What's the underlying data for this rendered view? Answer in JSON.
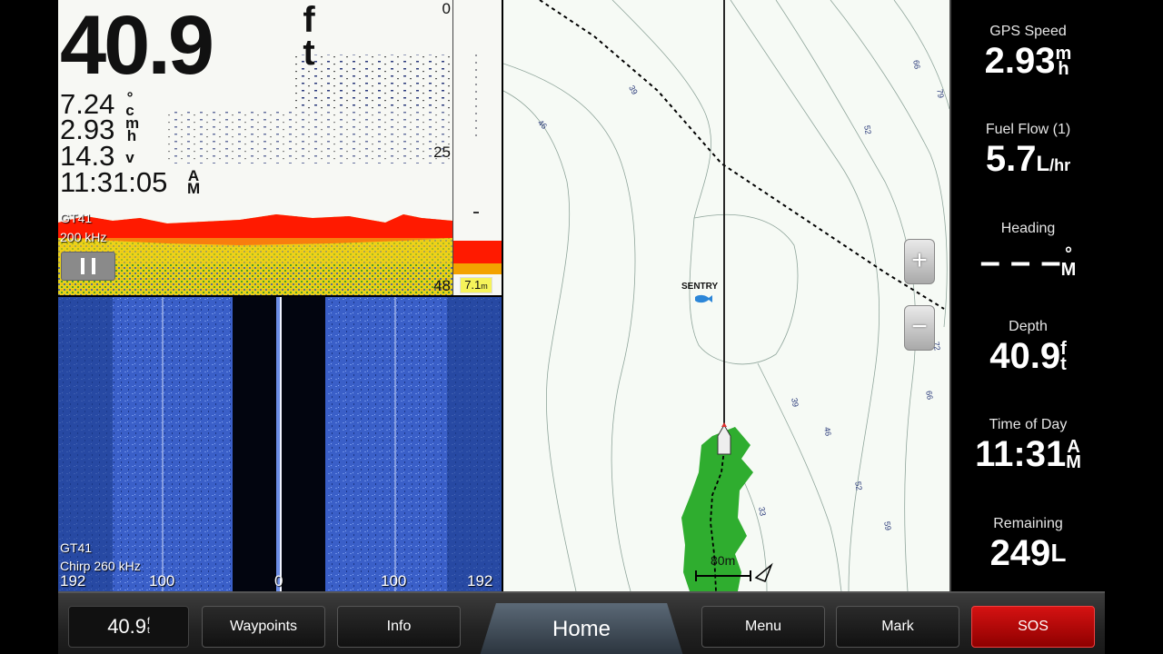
{
  "sonar": {
    "depth_value": "40.9",
    "depth_unit": [
      "f",
      "t"
    ],
    "water_temp": "7.24",
    "water_temp_unit": [
      "°",
      "c"
    ],
    "speed": "2.93",
    "speed_unit": [
      "m",
      "h"
    ],
    "voltage": "14.3",
    "voltage_unit": "v",
    "time": "11:31:05",
    "time_unit": [
      "A",
      "M"
    ],
    "transducer": "GT41",
    "frequency": "200 kHz",
    "scale": [
      "0",
      "25",
      "48"
    ],
    "flasher_depth": "7.1",
    "flasher_depth_unit": "m"
  },
  "sidescan": {
    "transducer": "GT41",
    "frequency": "Chirp 260 kHz",
    "scale": [
      "192",
      "100",
      "0",
      "100",
      "192"
    ]
  },
  "map": {
    "waypoint_label": "SENTRY",
    "scale_label": "80m",
    "contour_labels": [
      "39",
      "46",
      "52",
      "66",
      "79",
      "72",
      "66",
      "39",
      "46",
      "52",
      "59",
      "33"
    ],
    "zoom_in_label": "+",
    "zoom_out_label": "−"
  },
  "databar": {
    "fields": [
      {
        "title": "GPS Speed",
        "value": "2.93",
        "unit": [
          "m",
          "h"
        ]
      },
      {
        "title": "Fuel Flow (1)",
        "value": "5.7",
        "unit": [
          "L",
          "/hr"
        ]
      },
      {
        "title": "Heading",
        "value": "– – –",
        "unit": [
          "°",
          "M"
        ]
      },
      {
        "title": "Depth",
        "value": "40.9",
        "unit": [
          "f",
          "t"
        ]
      },
      {
        "title": "Time of Day",
        "value": "11:31",
        "unit": [
          "A",
          "M"
        ]
      },
      {
        "title": "Remaining",
        "value": "249",
        "unit": [
          "L",
          ""
        ]
      }
    ]
  },
  "bottombar": {
    "depth_value": "40.9",
    "depth_unit": [
      "f",
      "t"
    ],
    "waypoints": "Waypoints",
    "info": "Info",
    "home": "Home",
    "menu": "Menu",
    "mark": "Mark",
    "sos": "SOS"
  },
  "colors": {
    "sonar_bottom_red": "#ff1a00",
    "sidescan_blue": "#3a5fc8",
    "track_green": "#2fad2f",
    "sos_red": "#d51212"
  }
}
